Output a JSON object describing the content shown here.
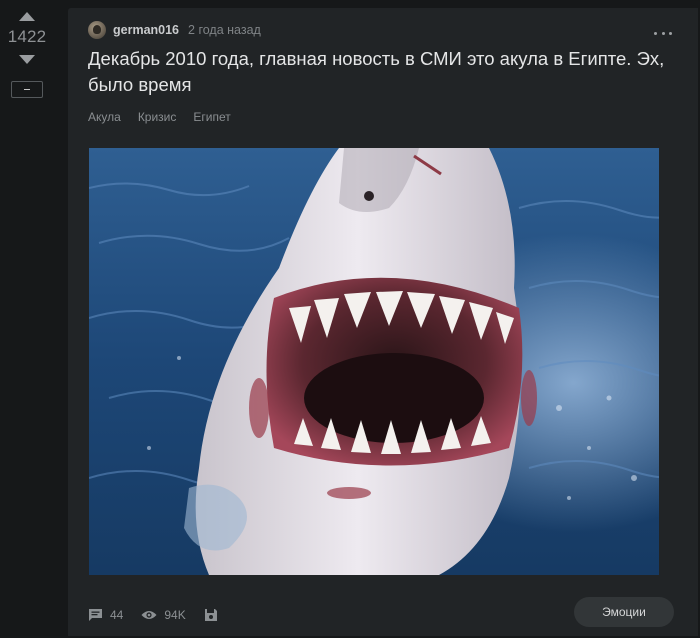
{
  "vote": {
    "count": "1422",
    "up_icon": "triangle-up-icon",
    "down_icon": "triangle-down-icon",
    "collapse_icon": "minus-icon"
  },
  "story": {
    "author": "german016",
    "time": "2 года назад",
    "title": "Декабрь 2010 года, главная новость в СМИ это акула в Египте. Эх, было время",
    "tags": [
      "Акула",
      "Кризис",
      "Египет"
    ],
    "image_subject": "shark-photo",
    "menu_icon": "more-dots-icon"
  },
  "footer": {
    "comments": "44",
    "views": "94K",
    "comments_icon": "comment-icon",
    "views_icon": "eye-icon",
    "save_icon": "floppy-save-icon",
    "emotions_label": "Эмоции"
  },
  "colors": {
    "page_bg": "#161819",
    "card_bg": "#212426",
    "text": "#e4e5e6",
    "muted": "#8a8e91",
    "button_bg": "#323638"
  }
}
